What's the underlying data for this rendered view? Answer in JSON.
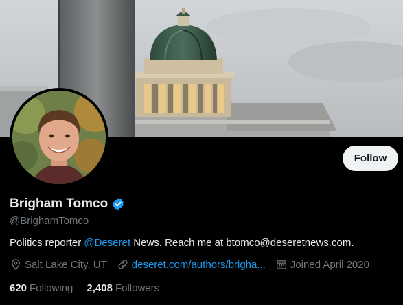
{
  "profile": {
    "display_name": "Brigham Tomco",
    "handle": "@BrighamTomco",
    "bio_prefix": "Politics reporter ",
    "bio_mention": "@Deseret",
    "bio_suffix": " News. Reach me at btomco@deseretnews.com.",
    "location": "Salt Lake City, UT",
    "website": "deseret.com/authors/brigha...",
    "joined": "Joined April 2020",
    "verified": true
  },
  "actions": {
    "follow_label": "Follow"
  },
  "stats": {
    "following_count": "620",
    "following_label": "Following",
    "followers_count": "2,408",
    "followers_label": "Followers"
  },
  "colors": {
    "accent": "#1d9bf0",
    "secondary_text": "#71767b",
    "primary_text": "#e7e9ea",
    "background": "#000000"
  },
  "icons": {
    "location": "location-pin-icon",
    "website": "link-icon",
    "joined": "calendar-icon",
    "verified": "verified-badge-icon"
  }
}
